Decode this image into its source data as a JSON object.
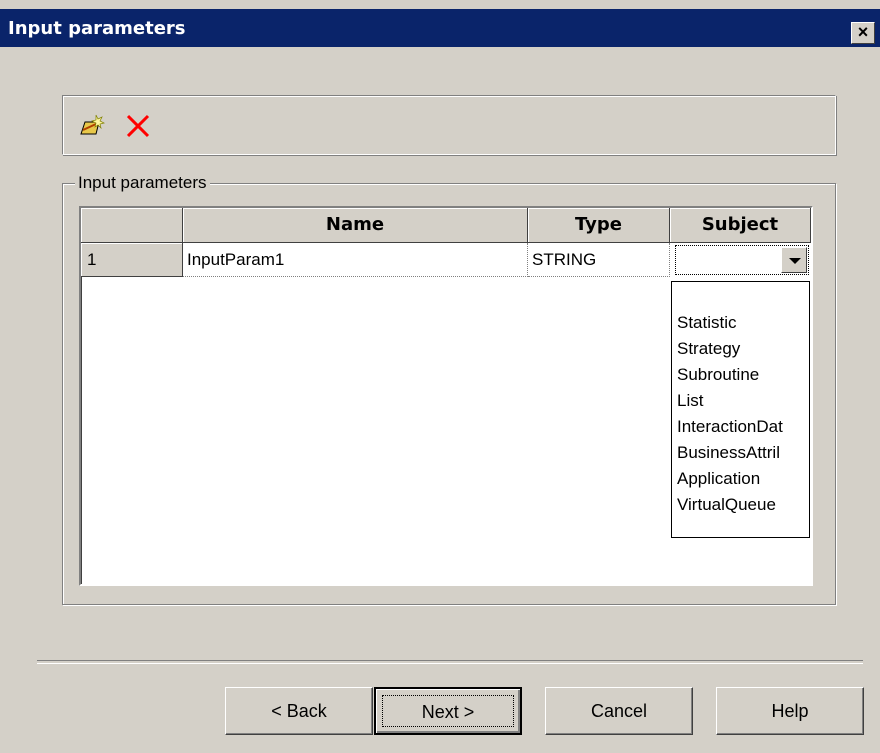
{
  "window": {
    "title": "Input parameters",
    "close_glyph": "×"
  },
  "toolbar": {
    "icons": [
      "new-parameter-icon",
      "delete-icon"
    ]
  },
  "group": {
    "legend": "Input parameters"
  },
  "grid": {
    "columns": [
      "Name",
      "Type",
      "Subject"
    ],
    "rows": [
      {
        "num": "1",
        "name": "InputParam1",
        "type": "STRING",
        "subject": ""
      }
    ]
  },
  "subject_dropdown": {
    "options": [
      "",
      "Statistic",
      "Strategy",
      "Subroutine",
      "List",
      "InteractionDat",
      "BusinessAttril",
      "Application",
      "VirtualQueue"
    ]
  },
  "buttons": {
    "back": "< Back",
    "next": "Next >",
    "cancel": "Cancel",
    "help": "Help"
  },
  "colors": {
    "titlebar": "#0a246a",
    "face": "#d4d0c8",
    "delete_icon": "#ff0000"
  }
}
